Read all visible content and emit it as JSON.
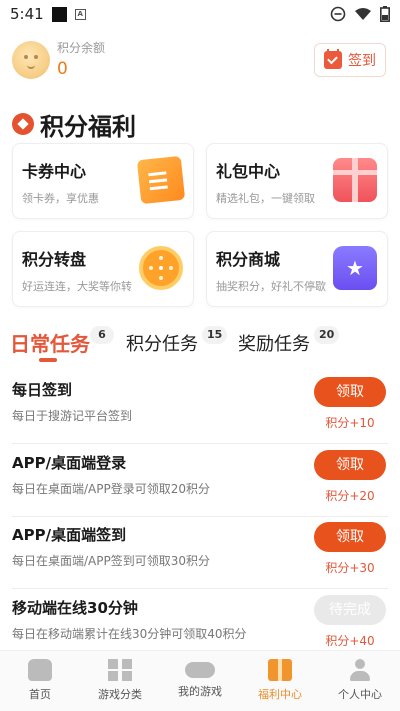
{
  "status_bar": {
    "time": "5:41",
    "icons": [
      "notification-square-icon",
      "a-box-icon",
      "dnd-icon",
      "wifi-icon",
      "battery-icon"
    ]
  },
  "header": {
    "points_label": "积分余额",
    "points_value": "0",
    "signin_label": "签到"
  },
  "section_title": "积分福利",
  "cards": [
    {
      "title": "卡券中心",
      "subtitle": "领卡券，享优惠",
      "icon": "coupon-icon"
    },
    {
      "title": "礼包中心",
      "subtitle": "精选礼包，一键领取",
      "icon": "gift-box-icon"
    },
    {
      "title": "积分转盘",
      "subtitle": "好运连连，大奖等你转",
      "icon": "lucky-wheel-icon"
    },
    {
      "title": "积分商城",
      "subtitle": "抽奖积分，好礼不停歇",
      "icon": "shop-bag-icon"
    }
  ],
  "tabs": [
    {
      "label": "日常任务",
      "badge": "6",
      "active": true
    },
    {
      "label": "积分任务",
      "badge": "15",
      "active": false
    },
    {
      "label": "奖励任务",
      "badge": "20",
      "active": false
    }
  ],
  "tasks": [
    {
      "title": "每日签到",
      "desc": "每日于搜游记平台签到",
      "button": "领取",
      "reward": "积分+10",
      "enabled": true
    },
    {
      "title": "APP/桌面端登录",
      "desc": "每日在桌面端/APP登录可领取20积分",
      "button": "领取",
      "reward": "积分+20",
      "enabled": true
    },
    {
      "title": "APP/桌面端签到",
      "desc": "每日在桌面端/APP签到可领取30积分",
      "button": "领取",
      "reward": "积分+30",
      "enabled": true
    },
    {
      "title": "移动端在线30分钟",
      "desc": "每日在移动端累计在线30分钟可领取40积分",
      "button": "待完成",
      "reward": "积分+40",
      "enabled": false
    }
  ],
  "bottom_nav": [
    {
      "label": "首页",
      "icon": "home-icon",
      "active": false
    },
    {
      "label": "游戏分类",
      "icon": "grid-icon",
      "active": false
    },
    {
      "label": "我的游戏",
      "icon": "gamepad-icon",
      "active": false
    },
    {
      "label": "福利中心",
      "icon": "gift-icon",
      "active": true
    },
    {
      "label": "个人中心",
      "icon": "user-icon",
      "active": false
    }
  ],
  "colors": {
    "accent": "#e4573a",
    "button": "#e8531d",
    "points": "#f07a1a",
    "nav_active": "#e88d2a"
  }
}
